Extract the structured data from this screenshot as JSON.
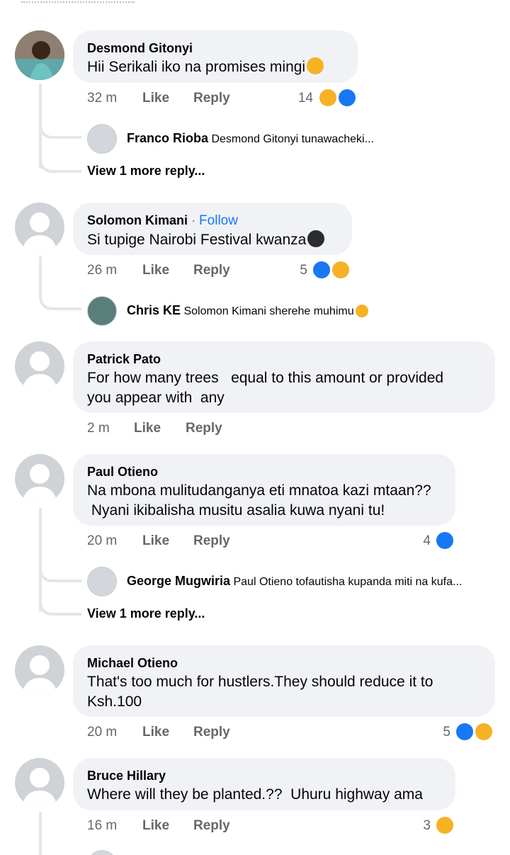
{
  "comments": [
    {
      "name": "Desmond Gitonyi",
      "text": "Hii Serikali iko na promises mingi",
      "time": "32 m",
      "like": "Like",
      "reply": "Reply",
      "count": "14",
      "reply_preview": {
        "name": "Franco Rioba",
        "text": "Desmond Gitonyi tunawacheki..."
      },
      "view_more": "View 1 more reply..."
    },
    {
      "name": "Solomon Kimani",
      "follow": "Follow",
      "text": "Si tupige Nairobi Festival kwanza",
      "time": "26 m",
      "like": "Like",
      "reply": "Reply",
      "count": "5",
      "reply_preview": {
        "name": "Chris KE",
        "text": "Solomon Kimani sherehe muhimu"
      }
    },
    {
      "name": "Patrick Pato",
      "text": "For how many trees   equal to this amount or provided\nyou appear with  any",
      "time": "2 m",
      "like": "Like",
      "reply": "Reply"
    },
    {
      "name": "Paul Otieno",
      "text": "Na mbona mulitudanganya eti mnatoa kazi mtaan??\n Nyani ikibalisha musitu asalia kuwa nyani tu!",
      "time": "20 m",
      "like": "Like",
      "reply": "Reply",
      "count": "4",
      "reply_preview": {
        "name": "George Mugwiria",
        "text": "Paul Otieno tofautisha kupanda miti na kufa..."
      },
      "view_more": "View 1 more reply..."
    },
    {
      "name": "Michael Otieno",
      "text": "That's too much for hustlers.They should reduce it to\nKsh.100",
      "time": "20 m",
      "like": "Like",
      "reply": "Reply",
      "count": "5"
    },
    {
      "name": "Bruce Hillary",
      "text": "Where will they be planted.??  Uhuru highway ama",
      "time": "16 m",
      "like": "Like",
      "reply": "Reply",
      "count": "3"
    }
  ],
  "colors": {
    "like": "#1877f2",
    "haha": "#f7b125",
    "bubble": "#f0f2f5"
  }
}
